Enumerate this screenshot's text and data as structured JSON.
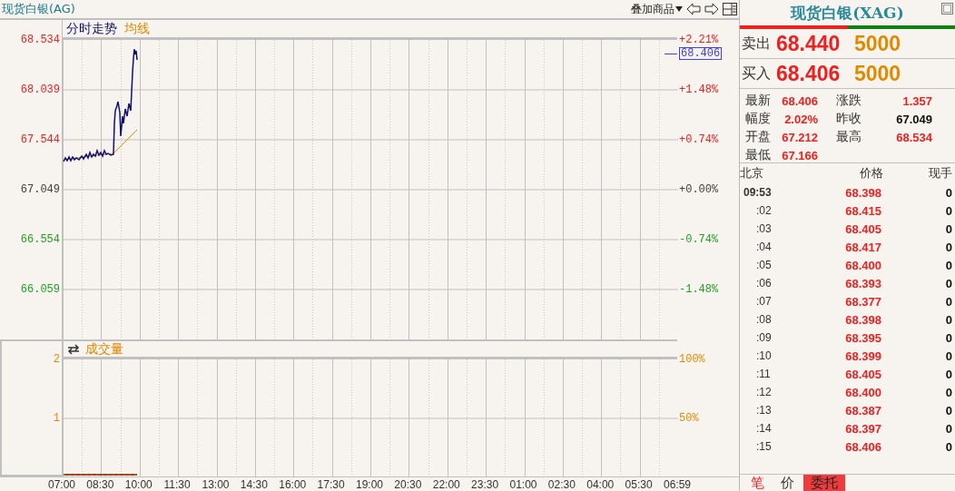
{
  "title_bar": {
    "title": "现货白银(AG)",
    "overlay_menu": "叠加商品"
  },
  "price_chart": {
    "tabs": [
      {
        "label": "分时走势",
        "kind": "price"
      },
      {
        "label": "均线",
        "kind": "average"
      }
    ],
    "price_labels": [
      {
        "text": "68.534",
        "color": "#ee2020"
      },
      {
        "text": "68.039",
        "color": "#ee2020"
      },
      {
        "text": "67.544",
        "color": "#ee2020"
      },
      {
        "text": "67.049",
        "color": "#404040"
      },
      {
        "text": "66.554",
        "color": "#20a020"
      },
      {
        "text": "66.059",
        "color": "#20a020"
      }
    ],
    "percent_labels": [
      {
        "text": "+2.21%",
        "color": "#ee2020"
      },
      {
        "text": "+1.48%",
        "color": "#ee2020"
      },
      {
        "text": "+0.74%",
        "color": "#ee2020"
      },
      {
        "text": "+0.00%",
        "color": "#404040"
      },
      {
        "text": "-0.74%",
        "color": "#20a020"
      },
      {
        "text": "-1.48%",
        "color": "#20a020"
      }
    ],
    "last_price_tag": "68.406"
  },
  "volume_chart": {
    "title": "成交量",
    "left_labels": [
      "2",
      "1"
    ],
    "right_labels": [
      "100%",
      "50%"
    ]
  },
  "time_axis": [
    "07:00",
    "08:30",
    "10:00",
    "11:30",
    "13:00",
    "14:30",
    "16:00",
    "17:30",
    "19:00",
    "20:30",
    "22:00",
    "23:30",
    "01:00",
    "02:30",
    "04:00",
    "05:30",
    "06:59"
  ],
  "quote": {
    "title": "现货白银(XAG)",
    "orders": [
      {
        "label": "卖出",
        "price": "68.440",
        "volume": "5000"
      },
      {
        "label": "买入",
        "price": "68.406",
        "volume": "5000"
      }
    ],
    "stats": [
      {
        "label": "最新",
        "value": "68.406",
        "color": "#ee2020"
      },
      {
        "label": "涨跌",
        "value": "1.357",
        "color": "#ee2020"
      },
      {
        "label": "幅度",
        "value": "2.02%",
        "color": "#ee2020"
      },
      {
        "label": "昨收",
        "value": "67.049",
        "color": "#101010"
      },
      {
        "label": "开盘",
        "value": "67.212",
        "color": "#ee2020"
      },
      {
        "label": "最高",
        "value": "68.534",
        "color": "#ee2020"
      },
      {
        "label": "最低",
        "value": "67.166",
        "color": "#ee2020"
      }
    ],
    "ticks_header": [
      "北京",
      "价格",
      "现手"
    ],
    "ticks": [
      {
        "time": "09:53",
        "price": "68.398",
        "volume": "0"
      },
      {
        "time": ":02",
        "price": "68.415",
        "volume": "0"
      },
      {
        "time": ":03",
        "price": "68.405",
        "volume": "0"
      },
      {
        "time": ":04",
        "price": "68.417",
        "volume": "0"
      },
      {
        "time": ":05",
        "price": "68.400",
        "volume": "0"
      },
      {
        "time": ":06",
        "price": "68.393",
        "volume": "0"
      },
      {
        "time": ":07",
        "price": "68.377",
        "volume": "0"
      },
      {
        "time": ":08",
        "price": "68.398",
        "volume": "0"
      },
      {
        "time": ":09",
        "price": "68.395",
        "volume": "0"
      },
      {
        "time": ":10",
        "price": "68.399",
        "volume": "0"
      },
      {
        "time": ":11",
        "price": "68.405",
        "volume": "0"
      },
      {
        "time": ":12",
        "price": "68.400",
        "volume": "0"
      },
      {
        "time": ":13",
        "price": "68.387",
        "volume": "0"
      },
      {
        "time": ":14",
        "price": "68.397",
        "volume": "0"
      },
      {
        "time": ":15",
        "price": "68.406",
        "volume": "0"
      }
    ]
  },
  "bottom_tabs": [
    {
      "label": "笔",
      "selected": true,
      "highlight": false
    },
    {
      "label": "价",
      "selected": false,
      "highlight": false
    },
    {
      "label": "委托",
      "selected": false,
      "highlight": true
    }
  ]
}
